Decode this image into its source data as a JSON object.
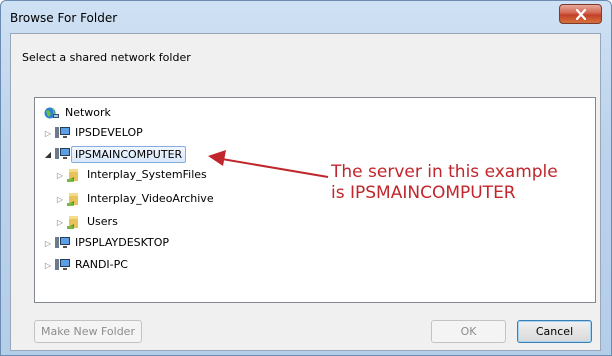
{
  "window": {
    "title": "Browse For Folder",
    "close_icon": "close-icon"
  },
  "dialog": {
    "prompt": "Select a shared network folder"
  },
  "tree": {
    "root": {
      "label": "Network",
      "icon": "network-icon"
    },
    "items": [
      {
        "label": "IPSDEVELOP",
        "icon": "computer-icon",
        "expander": "collapsed"
      },
      {
        "label": "IPSMAINCOMPUTER",
        "icon": "computer-icon",
        "expander": "expanded",
        "selected": true
      },
      {
        "label": "Interplay_SystemFiles",
        "icon": "shared-folder-icon",
        "expander": "collapsed"
      },
      {
        "label": "Interplay_VideoArchive",
        "icon": "shared-folder-icon",
        "expander": "collapsed"
      },
      {
        "label": "Users",
        "icon": "shared-folder-icon",
        "expander": "collapsed"
      },
      {
        "label": "IPSPLAYDESKTOP",
        "icon": "computer-icon",
        "expander": "collapsed"
      },
      {
        "label": "RANDI-PC",
        "icon": "computer-icon",
        "expander": "collapsed"
      }
    ]
  },
  "annotation": {
    "line1": "The server in this example",
    "line2": "is IPSMAINCOMPUTER",
    "color": "#c0262c"
  },
  "buttons": {
    "make_new_folder": "Make New Folder",
    "ok": "OK",
    "cancel": "Cancel"
  }
}
